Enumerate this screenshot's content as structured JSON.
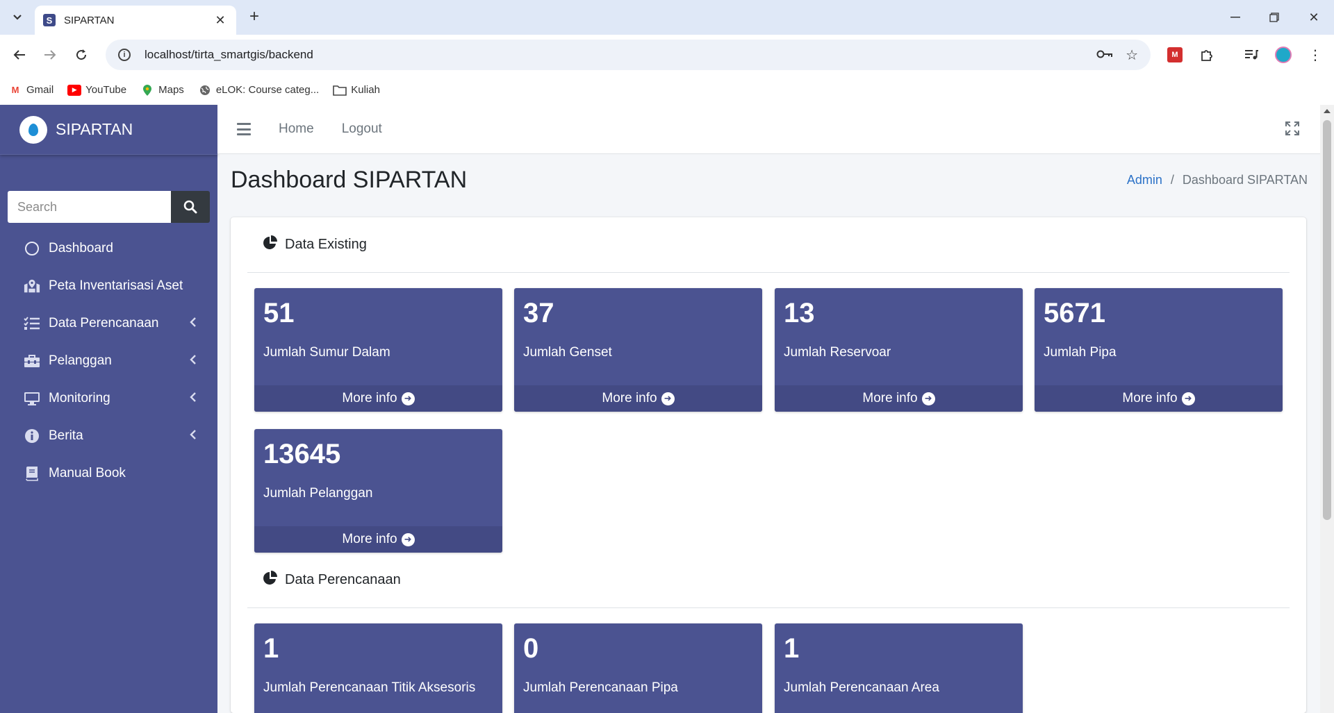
{
  "browser": {
    "tab_title": "SIPARTAN",
    "tab_favicon_letter": "S",
    "url": "localhost/tirta_smartgis/backend",
    "bookmarks": [
      {
        "label": "Gmail",
        "icon": "gmail-icon",
        "color": "#ea4335"
      },
      {
        "label": "YouTube",
        "icon": "youtube-icon",
        "color": "#ff0000"
      },
      {
        "label": "Maps",
        "icon": "maps-icon",
        "color": "#34a853"
      },
      {
        "label": "eLOK: Course categ...",
        "icon": "globe-icon",
        "color": "#555555"
      },
      {
        "label": "Kuliah",
        "icon": "folder-icon",
        "color": "#444444"
      }
    ]
  },
  "brand": {
    "name": "SIPARTAN"
  },
  "sidebar": {
    "search_placeholder": "Search",
    "items": [
      {
        "label": "Dashboard",
        "icon": "circle-icon",
        "has_arrow": false
      },
      {
        "label": "Peta Inventarisasi Aset",
        "icon": "map-marked-icon",
        "has_arrow": false
      },
      {
        "label": "Data Perencanaan",
        "icon": "tasks-icon",
        "has_arrow": true
      },
      {
        "label": "Pelanggan",
        "icon": "toolbox-icon",
        "has_arrow": true
      },
      {
        "label": "Monitoring",
        "icon": "desktop-icon",
        "has_arrow": true
      },
      {
        "label": "Berita",
        "icon": "info-circle-icon",
        "has_arrow": true
      },
      {
        "label": "Manual Book",
        "icon": "book-icon",
        "has_arrow": false
      }
    ]
  },
  "navbar": {
    "home": "Home",
    "logout": "Logout"
  },
  "header": {
    "title": "Dashboard SIPARTAN",
    "breadcrumb_root": "Admin",
    "breadcrumb_current": "Dashboard SIPARTAN"
  },
  "sections": {
    "existing": {
      "title": "Data Existing",
      "boxes": [
        {
          "value": "51",
          "label": "Jumlah Sumur Dalam",
          "footer": "More info"
        },
        {
          "value": "37",
          "label": "Jumlah Genset",
          "footer": "More info"
        },
        {
          "value": "13",
          "label": "Jumlah Reservoar",
          "footer": "More info"
        },
        {
          "value": "5671",
          "label": "Jumlah Pipa",
          "footer": "More info"
        },
        {
          "value": "13645",
          "label": "Jumlah Pelanggan",
          "footer": "More info"
        }
      ]
    },
    "perencanaan": {
      "title": "Data Perencanaan",
      "boxes": [
        {
          "value": "1",
          "label": "Jumlah Perencanaan Titik Aksesoris"
        },
        {
          "value": "0",
          "label": "Jumlah Perencanaan Pipa"
        },
        {
          "value": "1",
          "label": "Jumlah Perencanaan Area"
        }
      ]
    }
  },
  "colors": {
    "sidebar_bg": "#4b5391",
    "box_bg": "#4b5391",
    "box_footer_bg": "#434a84",
    "link": "#2c72c7"
  }
}
